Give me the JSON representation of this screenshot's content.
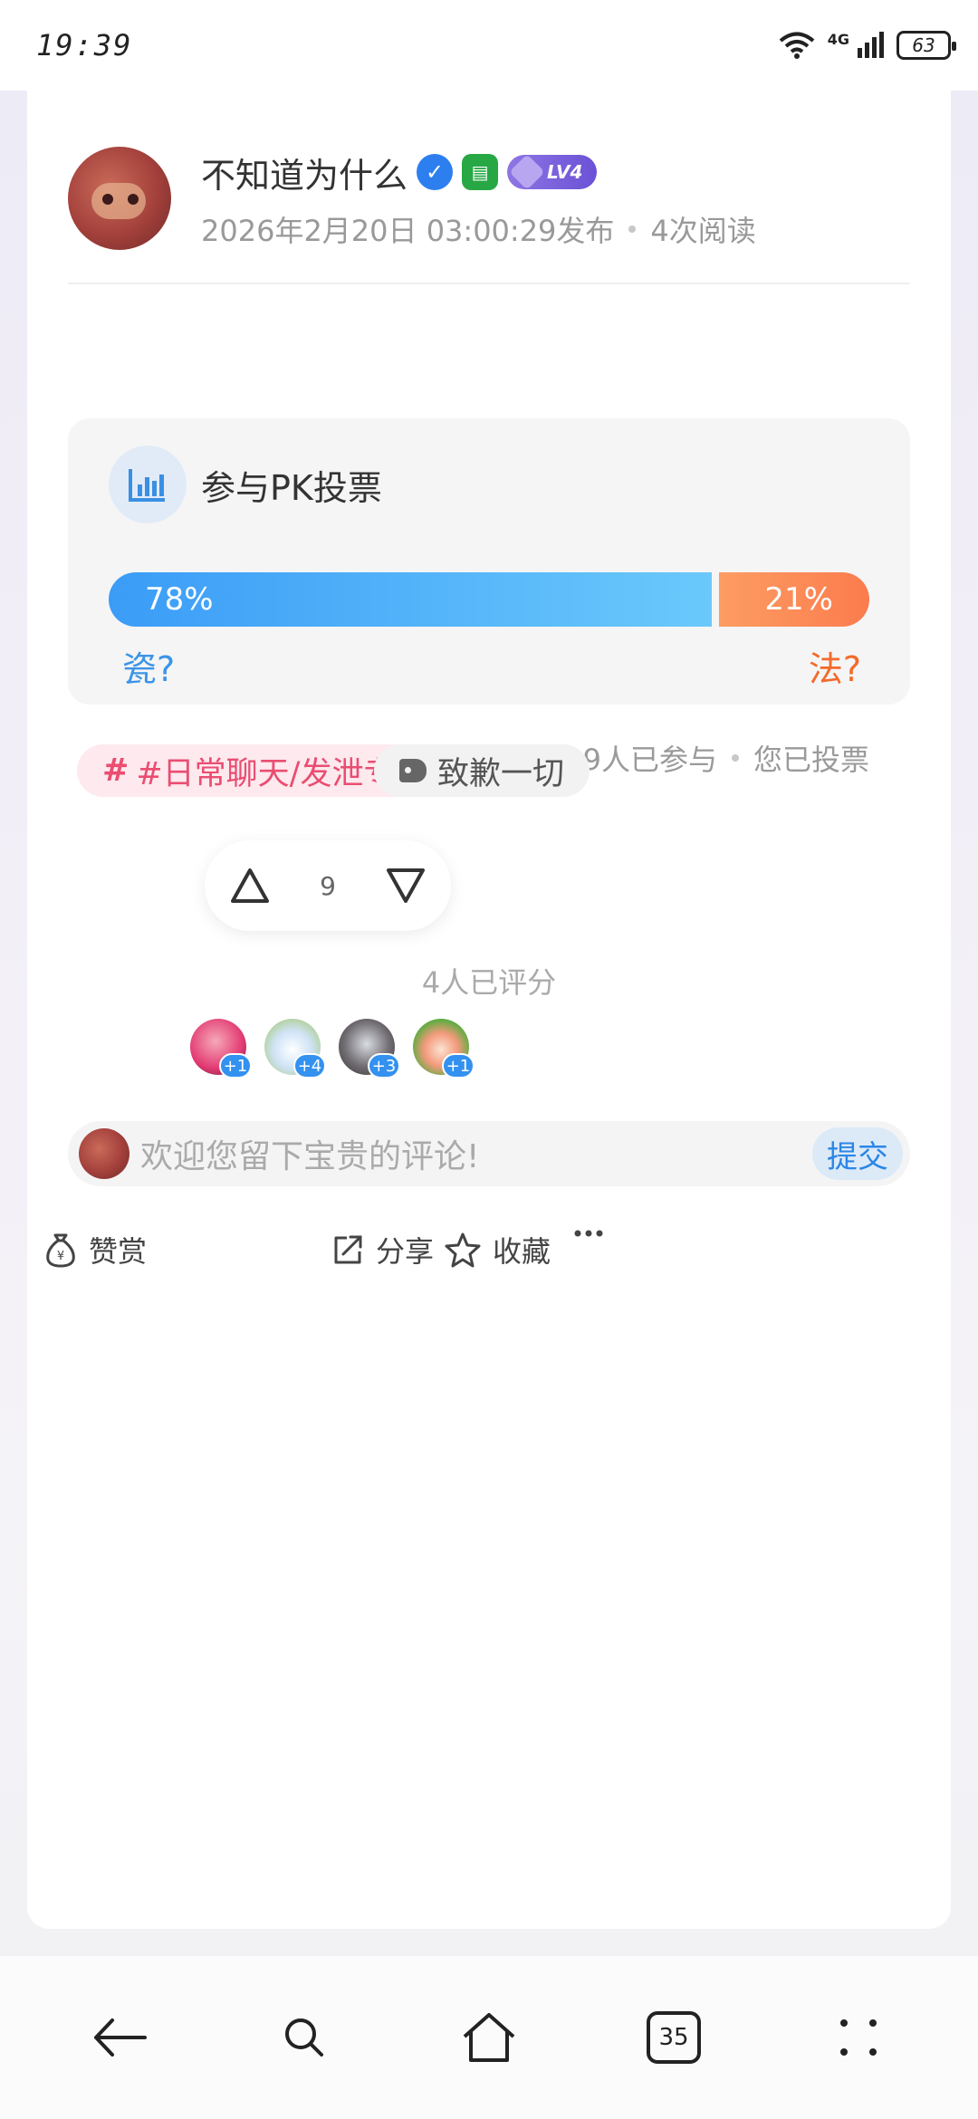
{
  "status_bar": {
    "time": "19:39",
    "network": "4G",
    "battery": "63"
  },
  "post": {
    "author": {
      "name": "不知道为什么",
      "level": "LV4"
    },
    "published": "2026年2月20日 03:00:29发布",
    "views": "4次阅读"
  },
  "pk_vote": {
    "title": "参与PK投票",
    "left": {
      "percent": "78%",
      "label": "瓷?",
      "share": 0.78
    },
    "right": {
      "percent": "21%",
      "label": "法?",
      "share": 0.21
    },
    "mode": "双选PK",
    "state": "已结束",
    "participants": "19人已参与",
    "my_status": "您已投票",
    "colors": {
      "left": "#3b9cf7",
      "right": "#fb7c4e"
    }
  },
  "tags": {
    "topic": "#日常聊天/发泄专用",
    "label": "致歉一切"
  },
  "rating": {
    "score": "9",
    "rated_text": "4人已评分",
    "raters": [
      "+1",
      "+4",
      "+3",
      "+1"
    ]
  },
  "comment": {
    "placeholder": "欢迎您留下宝贵的评论!",
    "submit": "提交"
  },
  "actions": {
    "reward": "赞赏",
    "share": "分享",
    "favorite": "收藏"
  },
  "nav": {
    "tab_count": "35"
  }
}
